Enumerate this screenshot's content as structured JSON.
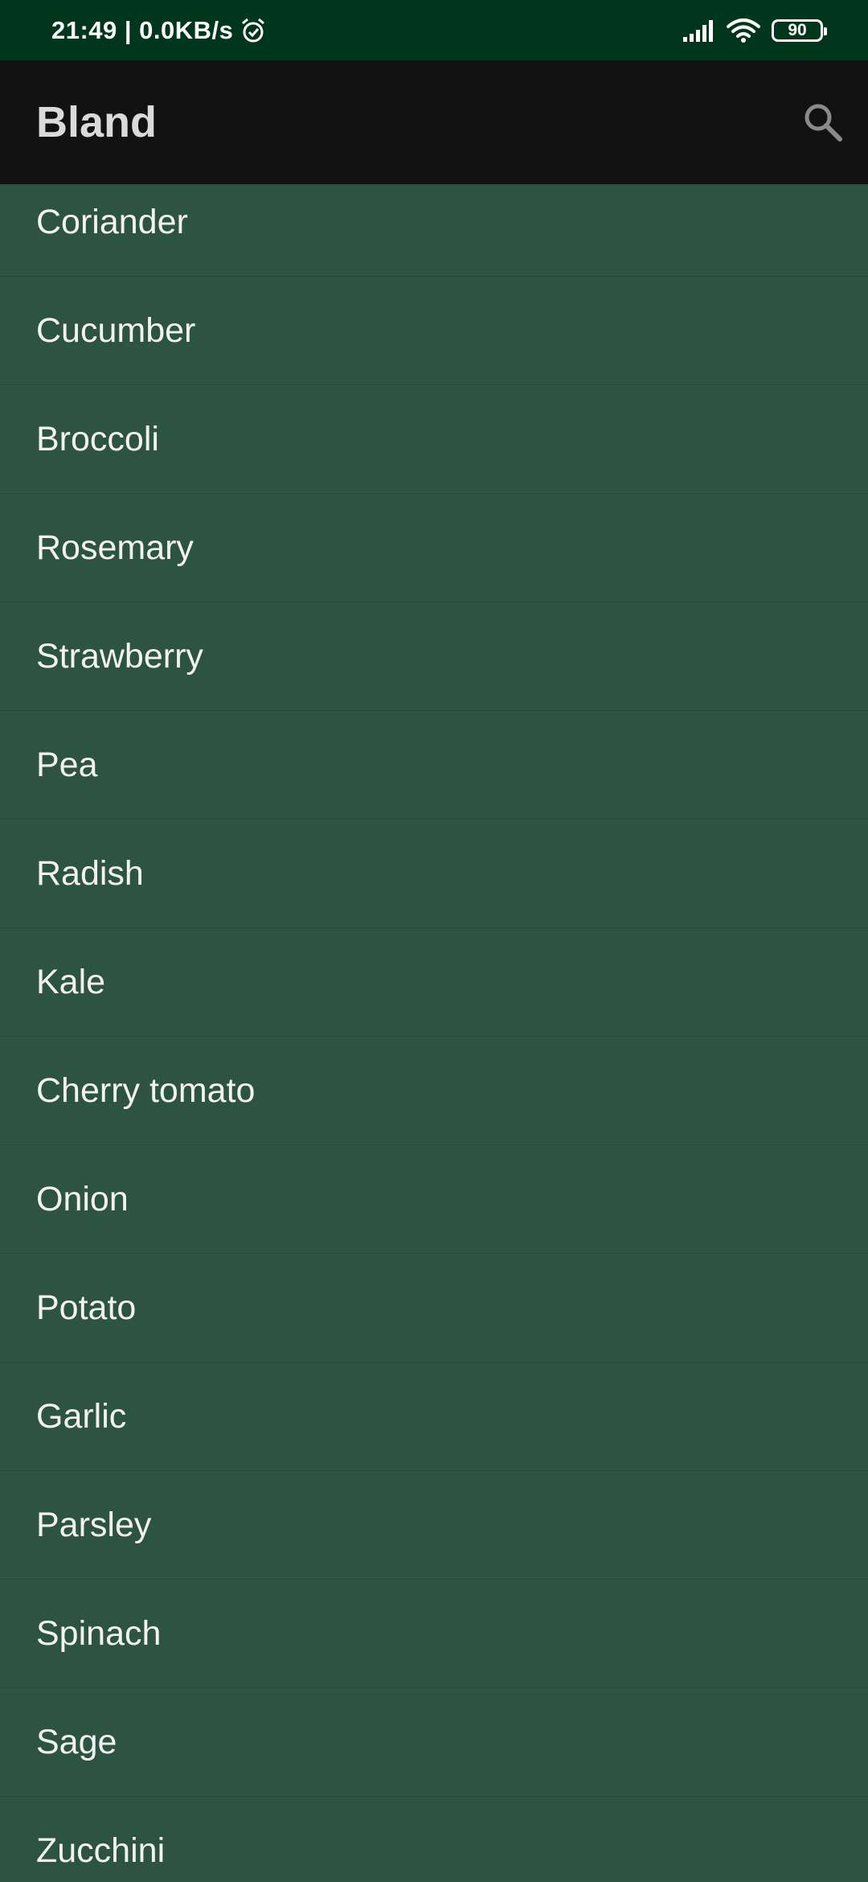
{
  "status_bar": {
    "time_speed": "21:49 | 0.0KB/s",
    "battery": "90"
  },
  "app_bar": {
    "title": "Bland"
  },
  "list": {
    "items": [
      "Coriander",
      "Cucumber",
      "Broccoli",
      "Rosemary",
      "Strawberry",
      "Pea",
      "Radish",
      "Kale",
      "Cherry tomato",
      "Onion",
      "Potato",
      "Garlic",
      "Parsley",
      "Spinach",
      "Sage",
      "Zucchini"
    ]
  },
  "colors": {
    "status_bar_bg": "#00361c",
    "app_bar_bg": "#121212",
    "list_bg": "#2d5443"
  },
  "icons": [
    "alarm-icon",
    "signal-icon",
    "wifi-icon",
    "battery-icon",
    "search-icon"
  ]
}
